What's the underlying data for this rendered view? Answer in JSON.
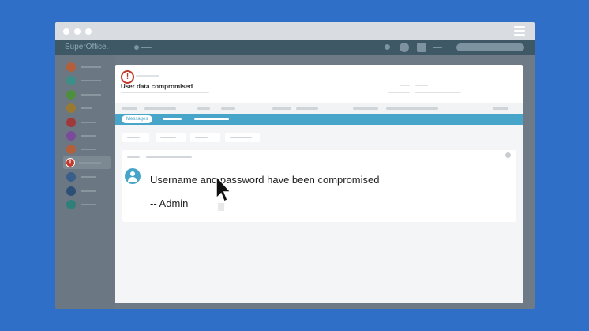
{
  "app": {
    "logo": "SuperOffice."
  },
  "panel": {
    "title": "User data compromised",
    "tabs": [
      {
        "label": "Messages"
      }
    ]
  },
  "message": {
    "text": "Username and password have been compromised",
    "signature": "-- Admin"
  },
  "icons": {
    "alert": "exclamation-circle-icon",
    "avatar": "user-avatar-icon",
    "cursor": "mouse-pointer-icon",
    "menu": "hamburger-menu-icon"
  },
  "colors": {
    "background": "#2f6fc8",
    "appbar": "#3e5866",
    "tabbar": "#47a5c9",
    "alert": "#c0392b"
  }
}
